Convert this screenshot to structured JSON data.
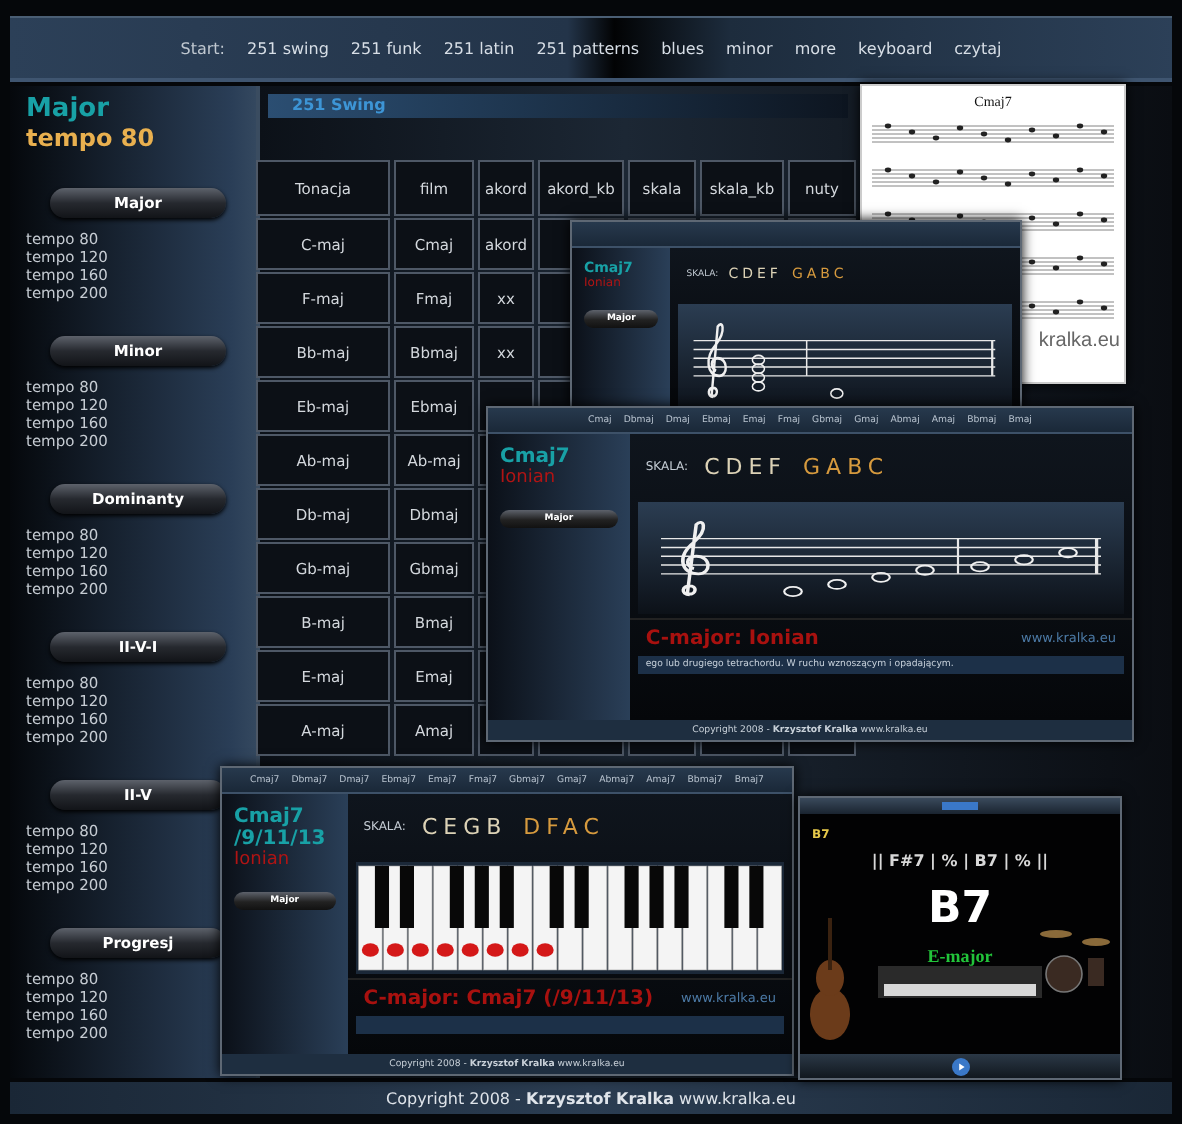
{
  "nav": {
    "label": "Start:",
    "links": [
      "251 swing",
      "251 funk",
      "251 latin",
      "251 patterns",
      "blues",
      "minor",
      "more",
      "keyboard",
      "czytaj"
    ]
  },
  "sidebar": {
    "title": "Major",
    "subtitle": "tempo 80",
    "sections": [
      {
        "button": "Major",
        "tempos": [
          "tempo 80",
          "tempo 120",
          "tempo 160",
          "tempo 200"
        ]
      },
      {
        "button": "Minor",
        "tempos": [
          "tempo 80",
          "tempo 120",
          "tempo 160",
          "tempo 200"
        ]
      },
      {
        "button": "Dominanty",
        "tempos": [
          "tempo 80",
          "tempo 120",
          "tempo 160",
          "tempo 200"
        ]
      },
      {
        "button": "II-V-I",
        "tempos": [
          "tempo 80",
          "tempo 120",
          "tempo 160",
          "tempo 200"
        ]
      },
      {
        "button": "II-V",
        "tempos": [
          "tempo 80",
          "tempo 120",
          "tempo 160",
          "tempo 200"
        ]
      },
      {
        "button": "Progresj",
        "tempos": [
          "tempo 80",
          "tempo 120",
          "tempo 160",
          "tempo 200"
        ]
      }
    ]
  },
  "main": {
    "header": "251 Swing",
    "table": {
      "columns": [
        "Tonacja",
        "film",
        "akord",
        "akord_kb",
        "skala",
        "skala_kb",
        "nuty"
      ],
      "rows": [
        {
          "cells": [
            "C-maj",
            "Cmaj",
            "akord"
          ]
        },
        {
          "cells": [
            "F-maj",
            "Fmaj",
            "xx"
          ]
        },
        {
          "cells": [
            "Bb-maj",
            "Bbmaj",
            "xx"
          ]
        },
        {
          "cells": [
            "Eb-maj",
            "Ebmaj"
          ]
        },
        {
          "cells": [
            "Ab-maj",
            "Ab-maj"
          ]
        },
        {
          "cells": [
            "Db-maj",
            "Dbmaj"
          ]
        },
        {
          "cells": [
            "Gb-maj",
            "Gbmaj"
          ]
        },
        {
          "cells": [
            "B-maj",
            "Bmaj"
          ]
        },
        {
          "cells": [
            "E-maj",
            "Emaj"
          ]
        },
        {
          "cells": [
            "A-maj",
            "Amaj"
          ]
        }
      ]
    }
  },
  "windows": [
    {
      "kind": "sheet",
      "title": "Cmaj7",
      "site": "kralka.eu"
    },
    {
      "kind": "scale",
      "chord": [
        "Cmaj7"
      ],
      "mode": "Ionian",
      "button": "Major",
      "scale_label": "SKALA:",
      "scale_notes": [
        "CDEF",
        "GABC"
      ]
    },
    {
      "kind": "scale",
      "nav": [
        "Cmaj",
        "Dbmaj",
        "Dmaj",
        "Ebmaj",
        "Emaj",
        "Fmaj",
        "Gbmaj",
        "Gmaj",
        "Abmaj",
        "Amaj",
        "Bbmaj",
        "Bmaj"
      ],
      "chord": [
        "Cmaj7"
      ],
      "mode": "Ionian",
      "button": "Major",
      "scale_label": "SKALA:",
      "scale_notes": [
        "CDEF",
        "GABC"
      ],
      "caption": "C-major: Ionian",
      "site": "www.kralka.eu",
      "note_text": "ego lub drugiego tetrachordu. W ruchu wznoszącym i opadającym.",
      "footer": "Copyright 2008 - **Krzysztof Kralka** www.kralka.eu"
    },
    {
      "kind": "keyboard",
      "nav": [
        "Cmaj7",
        "Dbmaj7",
        "Dmaj7",
        "Ebmaj7",
        "Emaj7",
        "Fmaj7",
        "Gbmaj7",
        "Gmaj7",
        "Abmaj7",
        "Amaj7",
        "Bbmaj7",
        "Bmaj7"
      ],
      "chord": [
        "Cmaj7",
        "/9/11/13"
      ],
      "mode": "Ionian",
      "button": "Major",
      "scale_label": "SKALA:",
      "scale_notes": [
        "CEGB",
        "DFAC"
      ],
      "caption": "C-major: Cmaj7 (/9/11/13)",
      "site": "www.kralka.eu",
      "footer": "Copyright 2008 - **Krzysztof Kralka** www.kralka.eu"
    },
    {
      "kind": "video",
      "small_chord": "B7",
      "progression": "|| F#7 | % | B7 | % ||",
      "chord": "B7",
      "key": "E-major"
    }
  ],
  "footer": "Copyright 2008 - **Krzysztof Kralka** www.kralka.eu"
}
